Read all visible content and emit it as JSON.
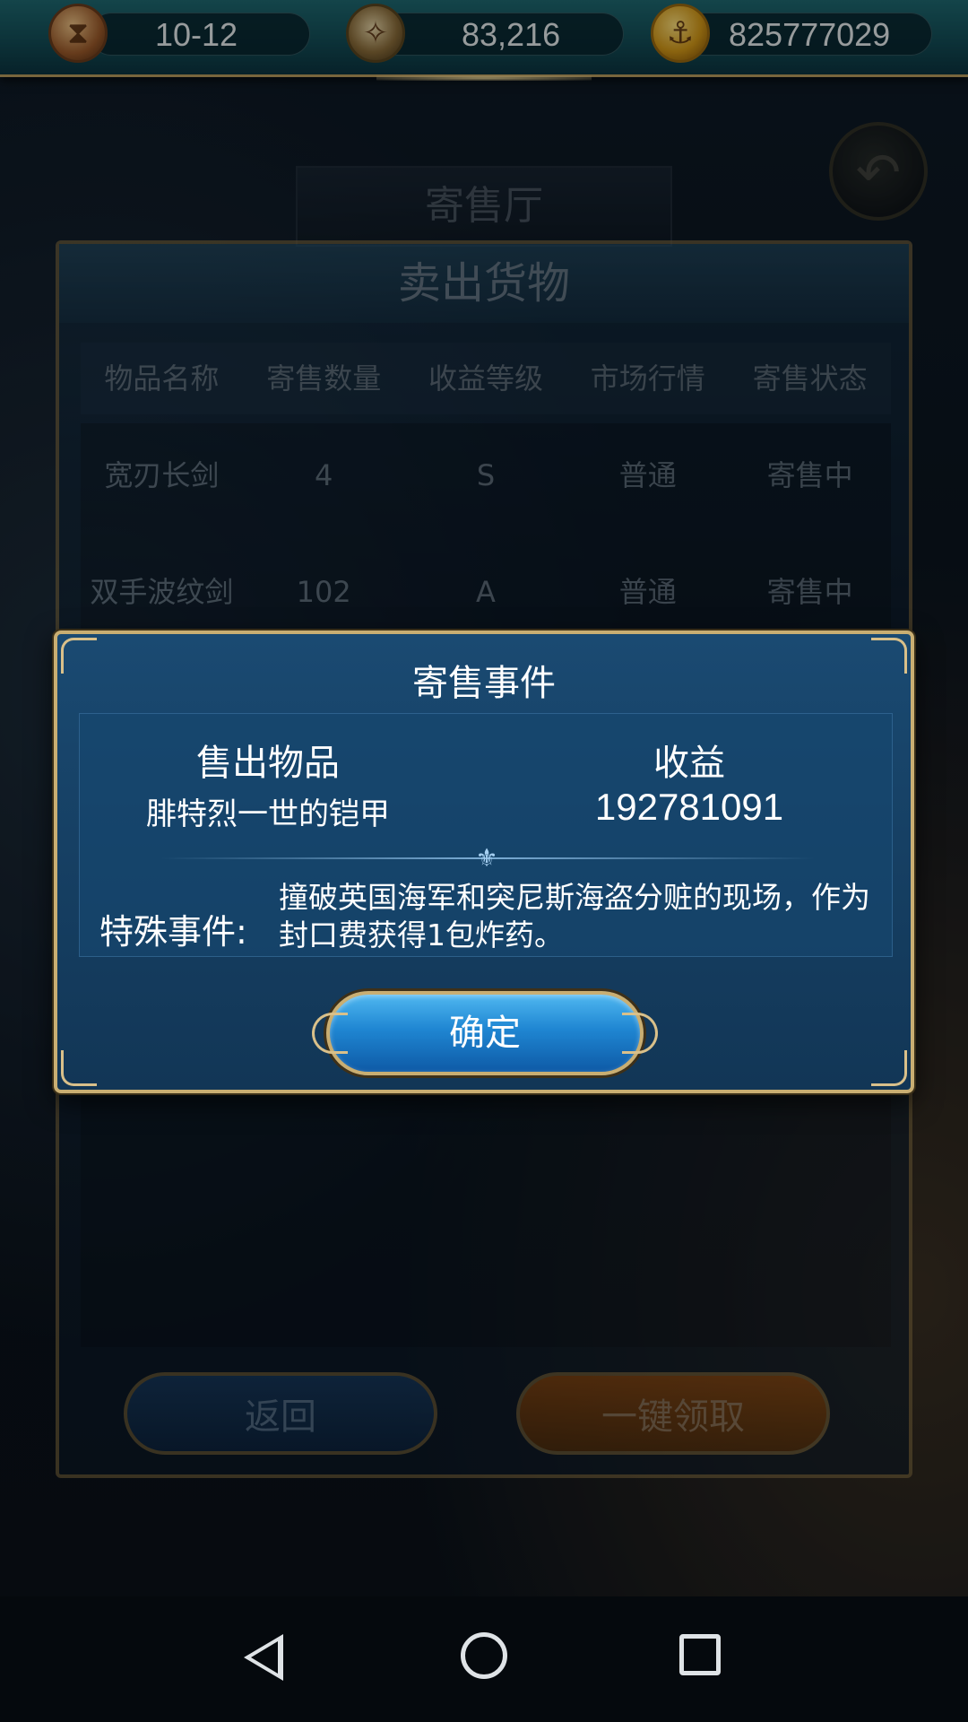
{
  "topbar": {
    "date": "10-12",
    "fame": "83,216",
    "gold": "825777029",
    "icons": [
      "hourglass-icon",
      "compass-icon",
      "gold-coin-icon"
    ]
  },
  "background": {
    "hall_title": "寄售厅",
    "panel_title": "卖出货物",
    "columns": [
      "物品名称",
      "寄售数量",
      "收益等级",
      "市场行情",
      "寄售状态"
    ],
    "rows": [
      {
        "name": "宽刃长剑",
        "qty": "4",
        "grade": "S",
        "market": "普通",
        "status": "寄售中"
      },
      {
        "name": "双手波纹剑",
        "qty": "102",
        "grade": "A",
        "market": "普通",
        "status": "寄售中"
      }
    ],
    "return_label": "返回",
    "collect_label": "一键领取"
  },
  "modal": {
    "title": "寄售事件",
    "sold_item_label": "售出物品",
    "sold_item": "腓特烈一世的铠甲",
    "revenue_label": "收益",
    "revenue": "192781091",
    "event_label": "特殊事件:",
    "event_text": "撞破英国海军和突尼斯海盗分赃的现场，作为封口费获得1包炸药。",
    "confirm_label": "确定"
  },
  "colors": {
    "accent_gold": "#c9ae72",
    "modal_blue": "#164064",
    "confirm_blue": "#1f86d2"
  }
}
